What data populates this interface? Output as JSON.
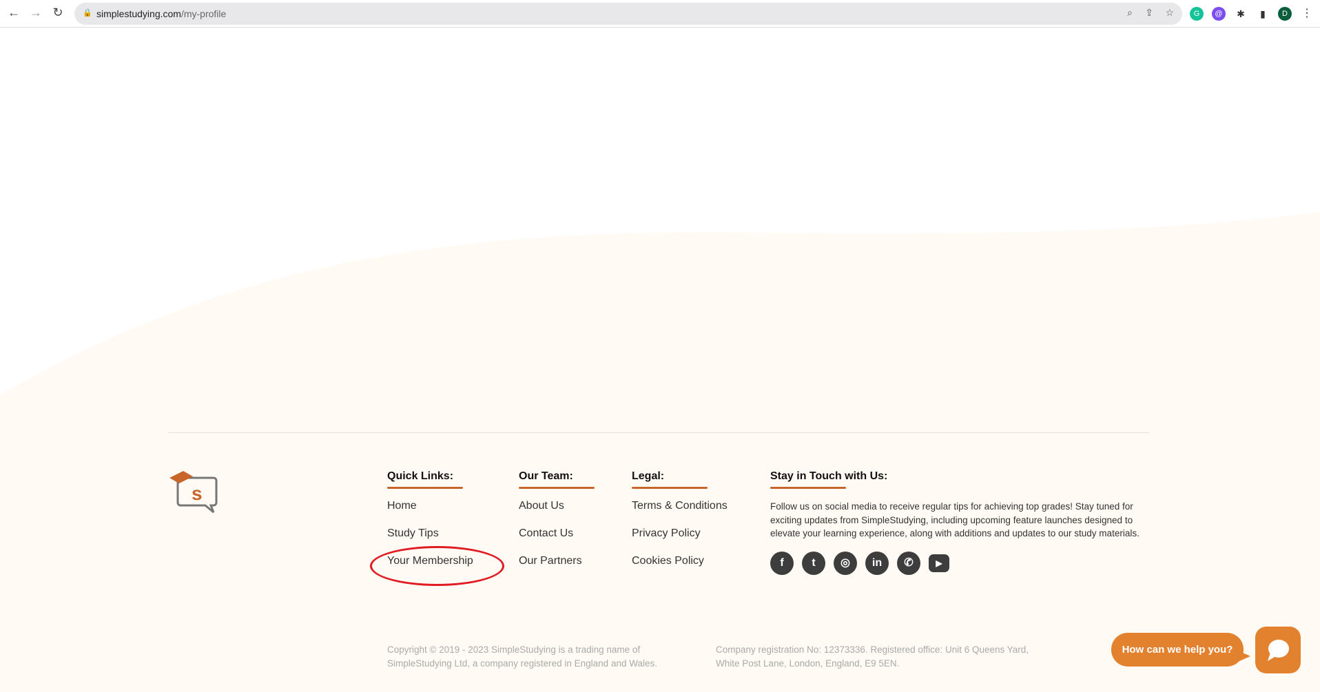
{
  "browser": {
    "url_domain": "simplestudying.com",
    "url_path": "/my-profile",
    "profile_initial": "D"
  },
  "footer": {
    "columns": [
      {
        "title": "Quick Links:",
        "links": [
          "Home",
          "Study Tips",
          "Your Membership"
        ]
      },
      {
        "title": "Our Team:",
        "links": [
          "About Us",
          "Contact Us",
          "Our Partners"
        ]
      },
      {
        "title": "Legal:",
        "links": [
          "Terms & Conditions",
          "Privacy Policy",
          "Cookies Policy"
        ]
      }
    ],
    "stay": {
      "title": "Stay in Touch with Us:",
      "text": "Follow us on social media to receive regular tips for achieving top grades! Stay tuned for exciting updates from SimpleStudying, including upcoming feature launches designed to elevate your learning experience, along with additions and updates to our study materials.",
      "social": [
        "facebook",
        "twitter",
        "instagram",
        "linkedin",
        "whatsapp",
        "youtube"
      ]
    },
    "copyright": "Copyright © 2019 - 2023 SimpleStudying is a trading name of SimpleStudying Ltd, a company registered in England and Wales.",
    "company": "Company registration No: 12373336. Registered office: Unit 6 Queens Yard, White Post Lane, London, England, E9 5EN."
  },
  "chat": {
    "label": "How can we help you?"
  },
  "colors": {
    "accent": "#e3822e",
    "cream": "#fffaf3",
    "highlight": "#e01b22"
  }
}
